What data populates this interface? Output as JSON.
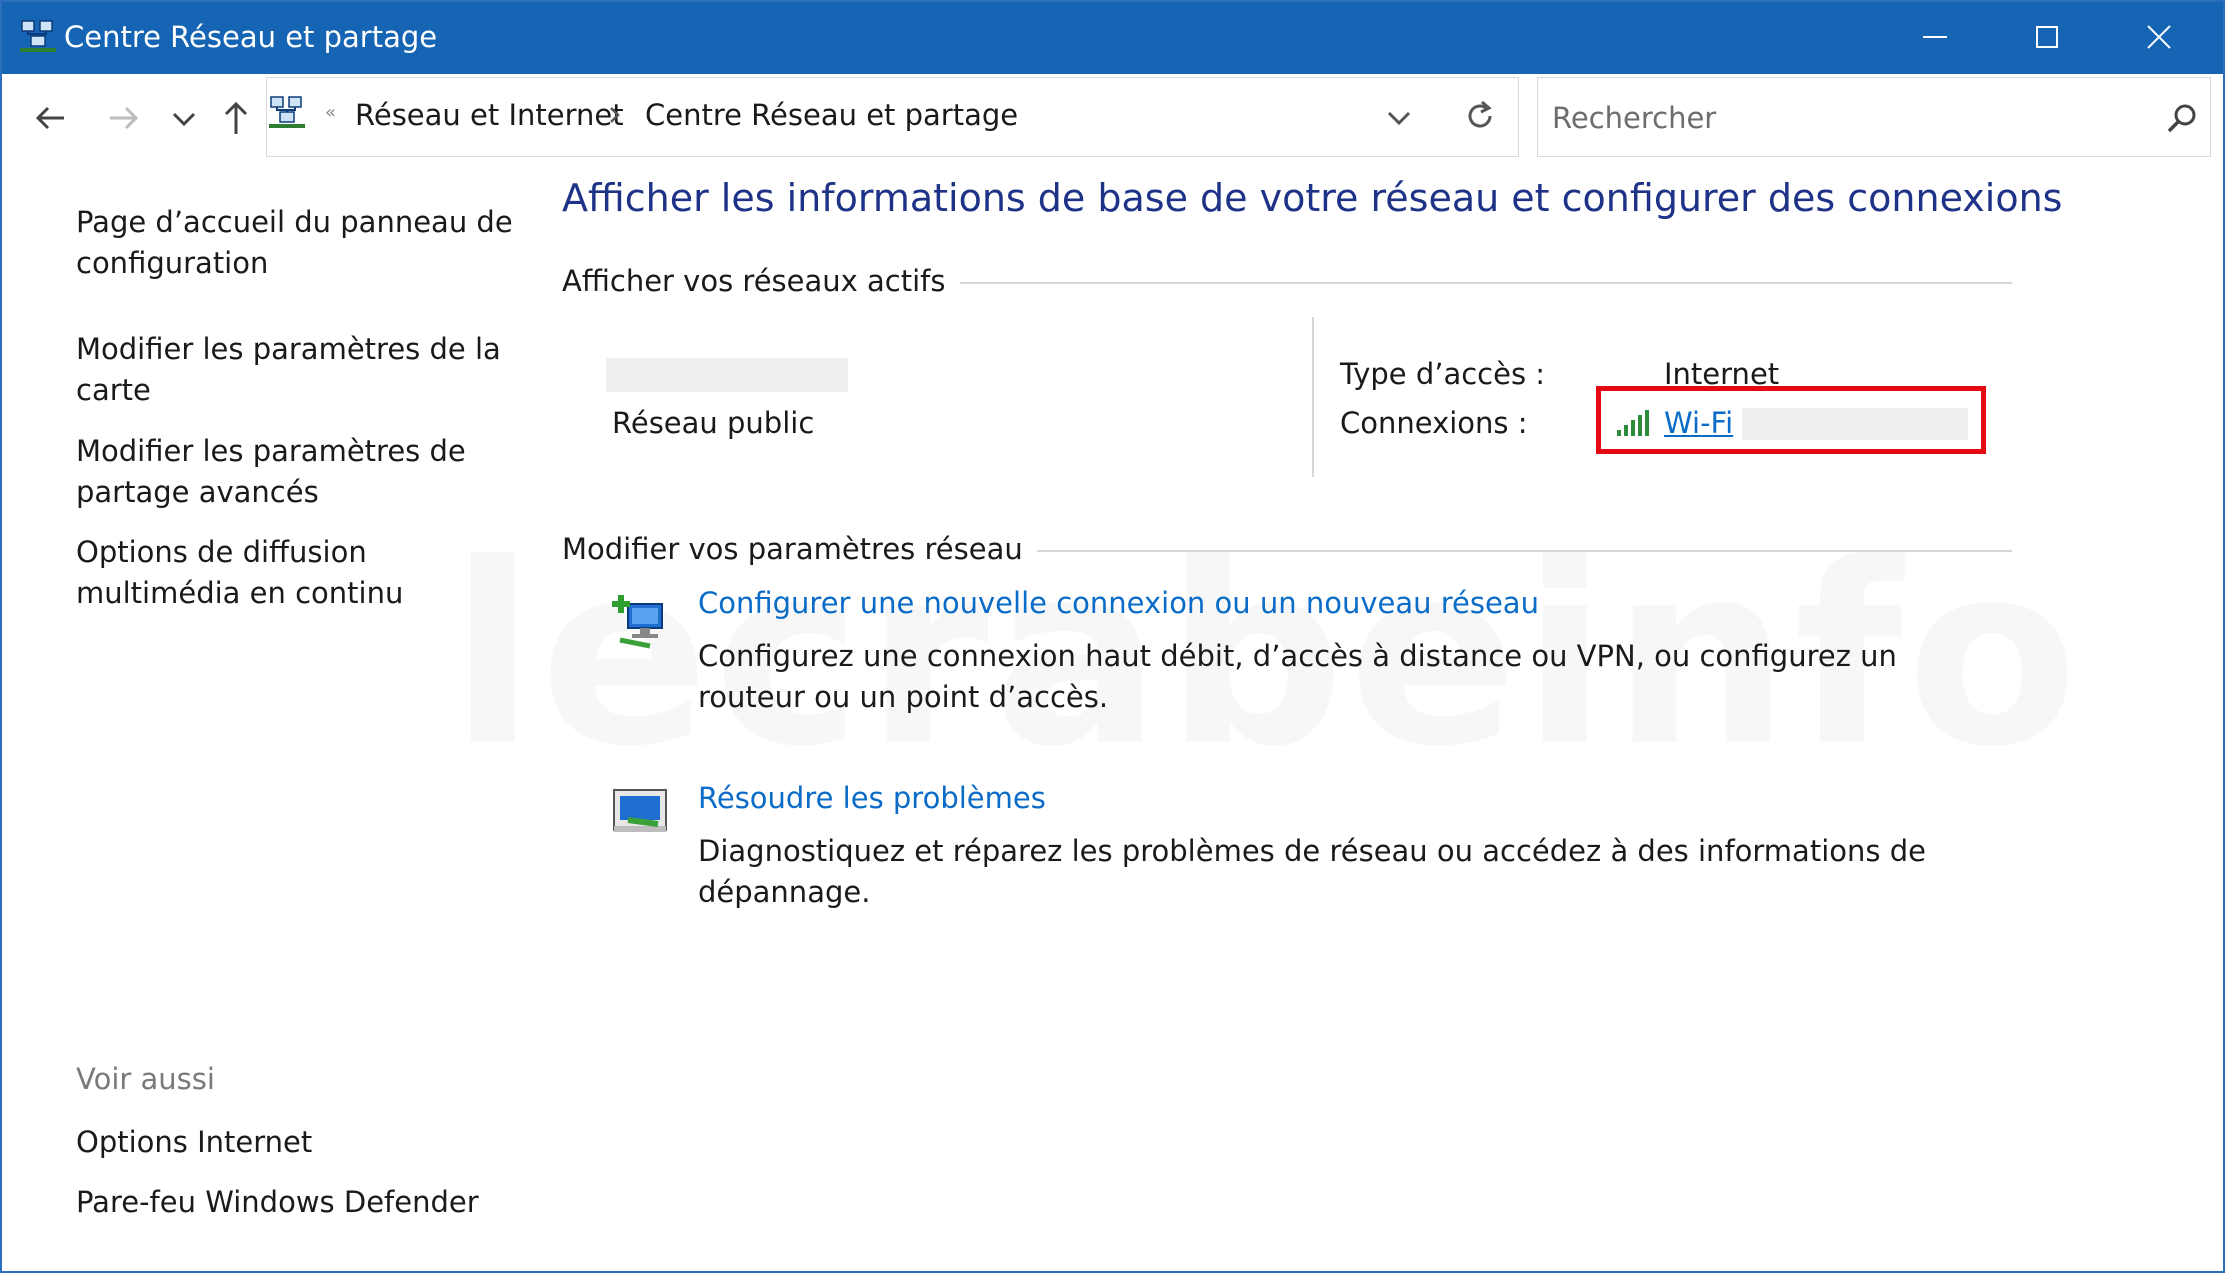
{
  "window": {
    "title": "Centre Réseau et partage",
    "titlebar_color": "#1565b4"
  },
  "nav": {
    "breadcrumb": [
      "Réseau et Internet",
      "Centre Réseau et partage"
    ],
    "search_placeholder": "Rechercher"
  },
  "sidebar": {
    "links": [
      "Page d’accueil du panneau de configuration",
      "Modifier les paramètres de la carte",
      "Modifier les paramètres de partage avancés",
      "Options de diffusion multimédia en continu"
    ],
    "see_also_label": "Voir aussi",
    "see_also_links": [
      "Options Internet",
      "Pare-feu Windows Defender"
    ]
  },
  "main": {
    "title": "Afficher les informations de base de votre réseau et configurer des connexions",
    "active_networks_heading": "Afficher vos réseaux actifs",
    "network": {
      "category": "Réseau public",
      "access_type_label": "Type d’accès :",
      "access_type_value": "Internet",
      "connections_label": "Connexions :",
      "connection_name": "Wi-Fi"
    },
    "change_settings_heading": "Modifier vos paramètres réseau",
    "tasks": [
      {
        "title": "Configurer une nouvelle connexion ou un nouveau réseau",
        "description": "Configurez une connexion haut débit, d’accès à distance ou VPN, ou configurez un routeur ou un point d’accès."
      },
      {
        "title": "Résoudre les problèmes",
        "description": "Diagnostiquez et réparez les problèmes de réseau ou accédez à des informations de dépannage."
      }
    ]
  },
  "watermark": "lecrabeinfo",
  "colors": {
    "link": "#0b6cc8",
    "heading": "#1e3287",
    "highlight": "#e50914"
  }
}
